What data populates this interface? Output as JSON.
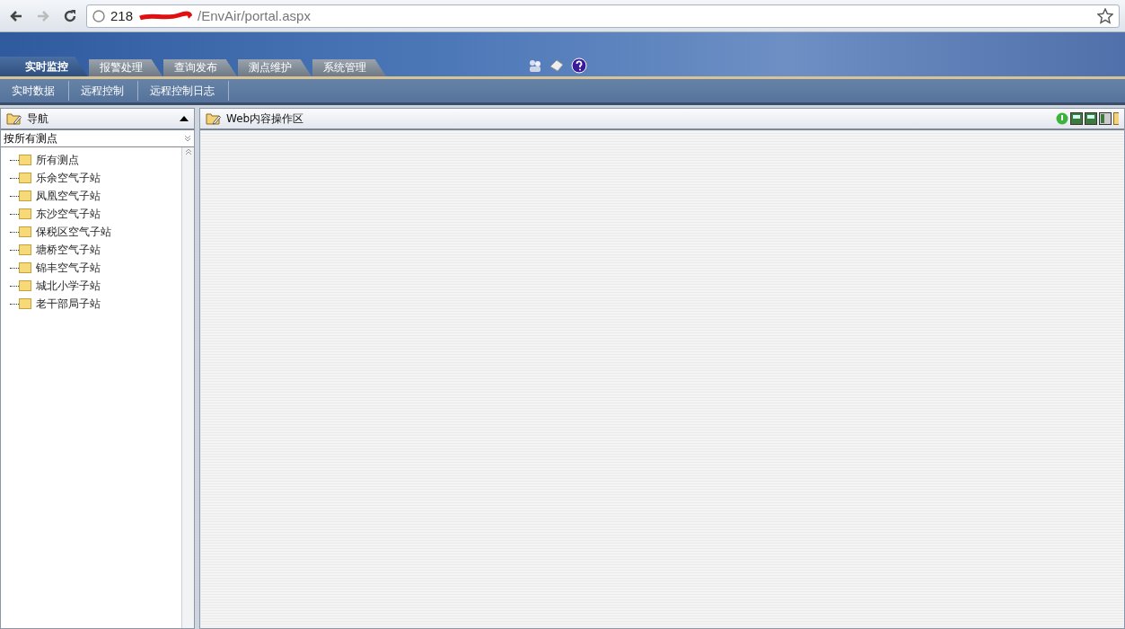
{
  "browser": {
    "url_start": "218",
    "url_end": "/EnvAir/portal.aspx"
  },
  "main_tabs": [
    {
      "label": "实时监控",
      "selected": true
    },
    {
      "label": "报警处理",
      "selected": false
    },
    {
      "label": "查询发布",
      "selected": false
    },
    {
      "label": "测点维护",
      "selected": false
    },
    {
      "label": "系统管理",
      "selected": false
    }
  ],
  "sub_nav": [
    "实时数据",
    "远程控制",
    "远程控制日志"
  ],
  "nav_panel": {
    "title": "导航",
    "filter": "按所有测点",
    "tree": [
      {
        "label": "所有测点"
      },
      {
        "label": "乐余空气子站"
      },
      {
        "label": "凤凰空气子站"
      },
      {
        "label": "东沙空气子站"
      },
      {
        "label": "保税区空气子站"
      },
      {
        "label": "塘桥空气子站"
      },
      {
        "label": "锦丰空气子站"
      },
      {
        "label": "城北小学子站"
      },
      {
        "label": "老干部局子站"
      }
    ]
  },
  "content_panel": {
    "title": "Web内容操作区"
  }
}
